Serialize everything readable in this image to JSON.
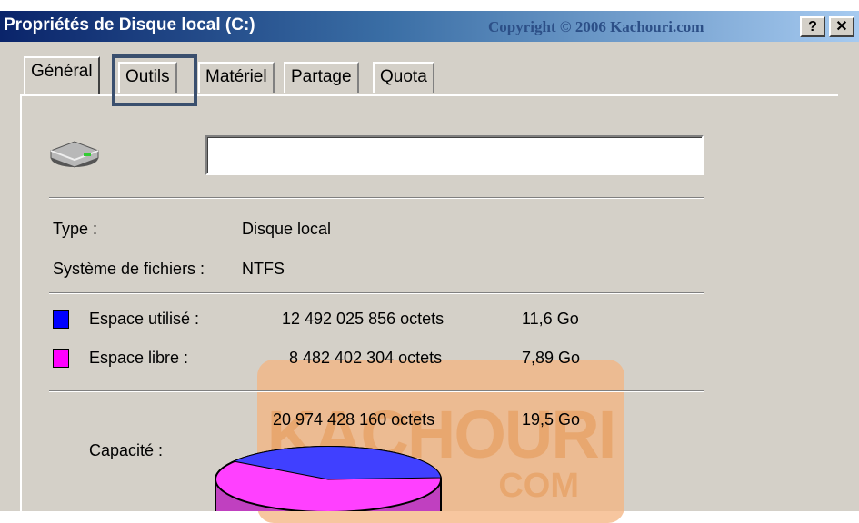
{
  "window": {
    "title": "Propriétés de Disque local (C:)",
    "watermark_copyright": "Copyright © 2006 Kachouri.com",
    "help_button": "?",
    "close_button": "✕"
  },
  "tabs": [
    {
      "label": "Général",
      "active": true
    },
    {
      "label": "Outils",
      "active": false,
      "highlighted": true
    },
    {
      "label": "Matériel",
      "active": false
    },
    {
      "label": "Partage",
      "active": false
    },
    {
      "label": "Quota",
      "active": false
    }
  ],
  "general": {
    "drive_icon": "hard-drive-icon",
    "volume_name": "",
    "type_label": "Type :",
    "type_value": "Disque local",
    "fs_label": "Système de fichiers :",
    "fs_value": "NTFS",
    "used": {
      "label": "Espace utilisé :",
      "bytes": "12 492 025 856 octets",
      "size": "11,6 Go",
      "color": "#0000ff"
    },
    "free": {
      "label": "Espace libre :",
      "bytes": "8 482 402 304 octets",
      "size": "7,89 Go",
      "color": "#ff00ff"
    },
    "capacity": {
      "label": "Capacité :",
      "bytes": "20 974 428 160 octets",
      "size": "19,5 Go"
    }
  },
  "watermark": {
    "text": "KACHOURI",
    "com": "COM"
  }
}
